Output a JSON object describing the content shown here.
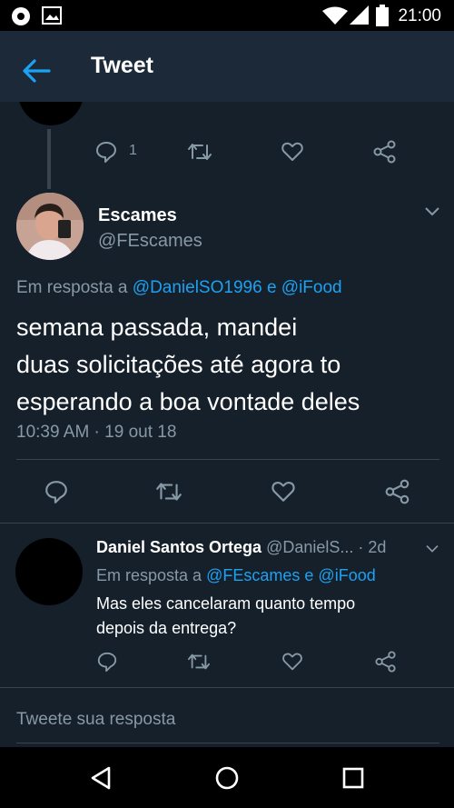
{
  "status_bar": {
    "time": "21:00"
  },
  "header": {
    "title": "Tweet"
  },
  "prev_tweet": {
    "reply_count": "1"
  },
  "main_tweet": {
    "author_name": "Escames",
    "author_handle": "@FEscames",
    "reply_prefix": "Em resposta a",
    "reply_user1": "@DanielSO1996",
    "reply_and": "e",
    "reply_user2": "@iFood",
    "text_line1": "semana passada, mandei",
    "text_line2": "duas solicitações até agora to",
    "text_line3": "esperando a boa vontade deles",
    "timestamp": "10:39 AM · 19 out 18"
  },
  "reply": {
    "author_name": "Daniel Santos Ortega",
    "author_handle": "@DanielS...",
    "age": "· 2d",
    "reply_prefix": "Em resposta a",
    "reply_user1": "@FEscames",
    "reply_and": "e",
    "reply_user2": "@iFood",
    "text_line1": "Mas eles cancelaram quanto tempo",
    "text_line2": "depois da entrega?"
  },
  "compose": {
    "placeholder": "Tweete sua resposta"
  },
  "colors": {
    "background": "#15202b",
    "accent": "#1da1f2",
    "muted": "#8899a6"
  }
}
